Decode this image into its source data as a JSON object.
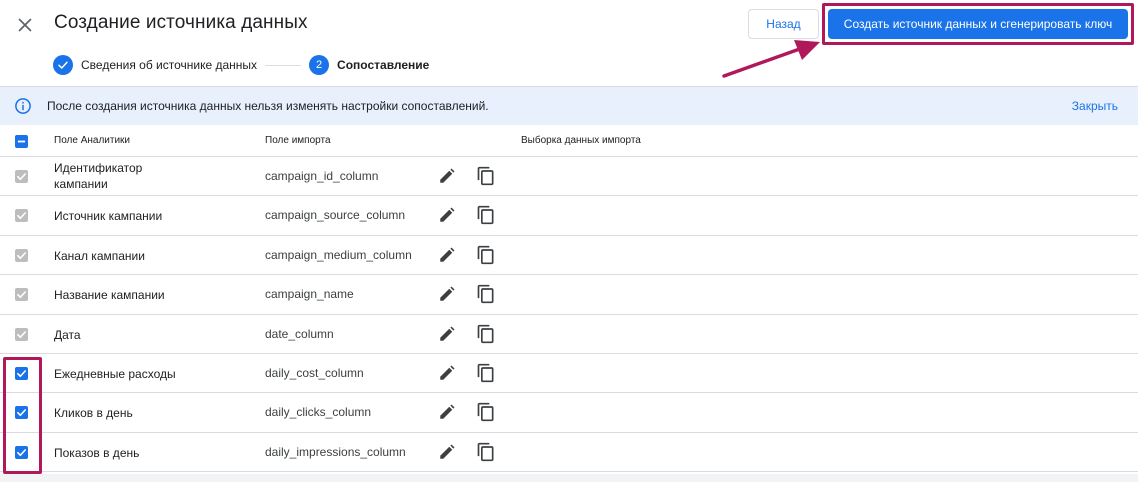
{
  "header": {
    "title": "Создание источника данных",
    "back_label": "Назад",
    "primary_label": "Создать источник данных и сгенерировать ключ"
  },
  "stepper": {
    "step1_label": "Сведения об источнике данных",
    "step2_number": "2",
    "step2_label": "Сопоставление"
  },
  "banner": {
    "text": "После создания источника данных нельзя изменять настройки сопоставлений.",
    "close_label": "Закрыть"
  },
  "table": {
    "columns": [
      "Поле Аналитики",
      "Поле импорта",
      "Выборка данных импорта"
    ],
    "rows": [
      {
        "name": "Идентификатор кампании",
        "import": "campaign_id_column",
        "checked": true,
        "locked": true
      },
      {
        "name": "Источник кампании",
        "import": "campaign_source_column",
        "checked": true,
        "locked": true
      },
      {
        "name": "Канал кампании",
        "import": "campaign_medium_column",
        "checked": true,
        "locked": true
      },
      {
        "name": "Название кампании",
        "import": "campaign_name",
        "checked": true,
        "locked": true
      },
      {
        "name": "Дата",
        "import": "date_column",
        "checked": true,
        "locked": true
      },
      {
        "name": "Ежедневные расходы",
        "import": "daily_cost_column",
        "checked": true,
        "locked": false
      },
      {
        "name": "Кликов в день",
        "import": "daily_clicks_column",
        "checked": true,
        "locked": false
      },
      {
        "name": "Показов в день",
        "import": "daily_impressions_column",
        "checked": true,
        "locked": false
      }
    ]
  },
  "colors": {
    "accent": "#1a73e8",
    "highlight": "#b0185a",
    "banner_bg": "#e8f0fe",
    "checkbox_disabled": "#bdbdbd"
  }
}
